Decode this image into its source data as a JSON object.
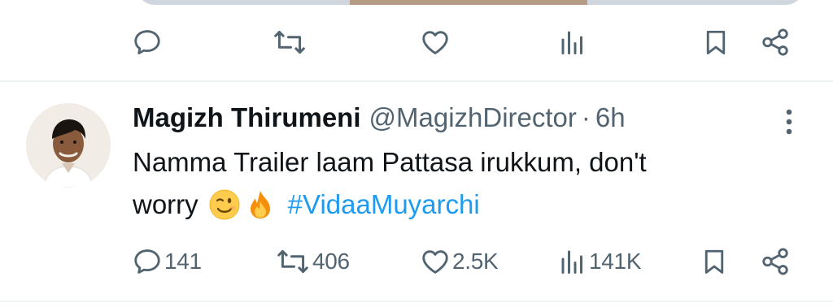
{
  "previous_tweet": {
    "actions": {
      "reply_icon": "comment-bubble-icon",
      "retweet_icon": "retweet-arrows-icon",
      "like_icon": "heart-outline-icon",
      "views_icon": "bar-chart-icon",
      "bookmark_icon": "bookmark-outline-icon",
      "share_icon": "share-nodes-icon"
    }
  },
  "tweet": {
    "author_name": "Magizh Thirumeni",
    "handle": "@MagizhDirector",
    "separator": "·",
    "time": "6h",
    "text_line1": "Namma Trailer laam Pattasa irukkum, don't",
    "text_line2_prefix": "worry",
    "emojis": [
      "winking-face-emoji",
      "fire-emoji"
    ],
    "hashtag": "#VidaaMuyarchi",
    "stats": {
      "replies": "141",
      "retweets": "406",
      "likes": "2.5K",
      "views": "141K"
    }
  },
  "colors": {
    "text": "#0f1419",
    "secondary": "#536471",
    "link": "#1d9bf0",
    "divider": "#eff3f4"
  }
}
